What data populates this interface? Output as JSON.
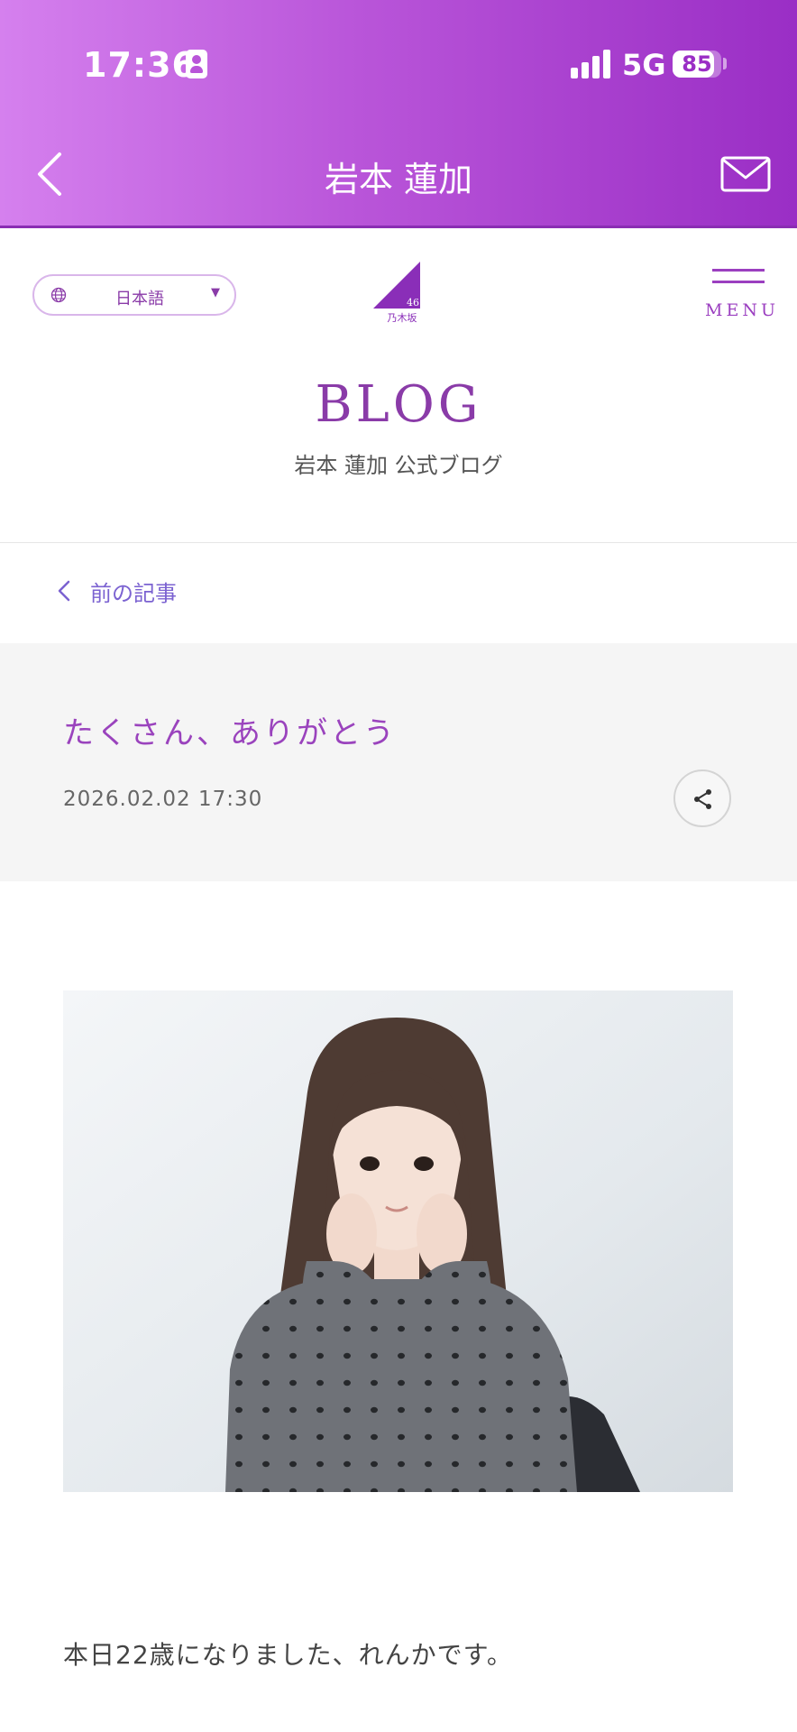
{
  "status": {
    "time": "17:36",
    "network": "5G",
    "battery": "85"
  },
  "header": {
    "title": "岩本 蓮加"
  },
  "site": {
    "language": "日本語",
    "menu_label": "MENU",
    "logo_text": "46\n乃木坂",
    "blog_title": "BLOG",
    "blog_subtitle": "岩本 蓮加 公式ブログ",
    "prev_article": "前の記事"
  },
  "article": {
    "title": "たくさん、ありがとう",
    "date": "2026.02.02 17:30",
    "body_first_line": "本日22歳になりました、れんかです。"
  },
  "colors": {
    "accent": "#9a43bd",
    "link": "#7b62d1",
    "header_start": "#d580ee",
    "header_end": "#9a2ec5"
  },
  "icons": [
    "back-chevron-icon",
    "mail-icon",
    "globe-icon",
    "caret-down-icon",
    "hamburger-icon",
    "share-icon",
    "chevron-left-icon"
  ]
}
